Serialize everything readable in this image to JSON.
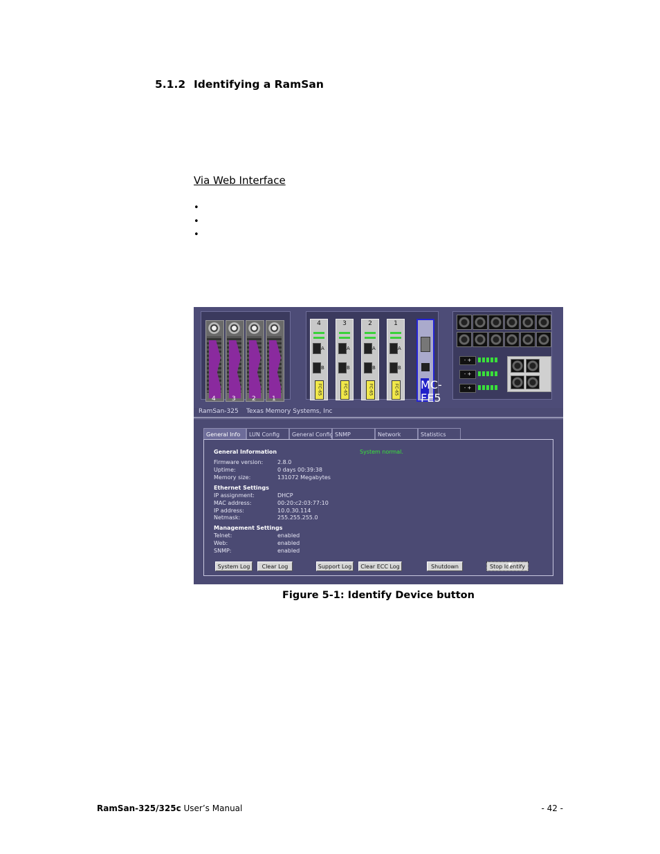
{
  "section": {
    "number": "5.1.2",
    "title": "Identifying a RamSan"
  },
  "subheading": "Via Web Interface",
  "bullets": [
    "•",
    "•",
    "•"
  ],
  "figure": {
    "drive_numbers": [
      "4",
      "3",
      "2",
      "1"
    ],
    "card_numbers": [
      "4",
      "3",
      "2",
      "1"
    ],
    "card_tag_text": "FC-65",
    "mgmt_tag_text": "MC-FE5",
    "port_labels": [
      "A",
      "B"
    ],
    "title_bar": {
      "product": "RamSan-325",
      "company": "Texas Memory Systems, Inc"
    },
    "tabs": [
      "General Info",
      "LUN Config",
      "General Config",
      "SNMP",
      "Network",
      "Statistics"
    ],
    "active_tab": "General Info",
    "status": "System normal.",
    "general_info": {
      "header": "General Information",
      "rows": [
        {
          "label": "Firmware version:",
          "value": "2.8.0"
        },
        {
          "label": "Uptime:",
          "value": "0 days 00:39:38"
        },
        {
          "label": "Memory size:",
          "value": "131072 Megabytes"
        }
      ]
    },
    "ethernet": {
      "header": "Ethernet Settings",
      "rows": [
        {
          "label": "IP assignment:",
          "value": "DHCP"
        },
        {
          "label": "MAC address:",
          "value": "00:20:c2:03:77:10"
        },
        {
          "label": "IP address:",
          "value": "10.0.30.114"
        },
        {
          "label": "Netmask:",
          "value": "255.255.255.0"
        }
      ]
    },
    "management": {
      "header": "Management Settings",
      "rows": [
        {
          "label": "Telnet:",
          "value": "enabled"
        },
        {
          "label": "Web:",
          "value": "enabled"
        },
        {
          "label": "SNMP:",
          "value": "enabled"
        }
      ]
    },
    "buttons": [
      "System Log",
      "Clear Log",
      "Support Log",
      "Clear ECC Log",
      "Shutdown",
      "Stop Identify"
    ],
    "psu_switch_label": "-  +"
  },
  "caption": "Figure 5-1: Identify Device button",
  "footer": {
    "product": "RamSan-325/325c",
    "manual": " User’s Manual",
    "page": "- 42 -"
  }
}
